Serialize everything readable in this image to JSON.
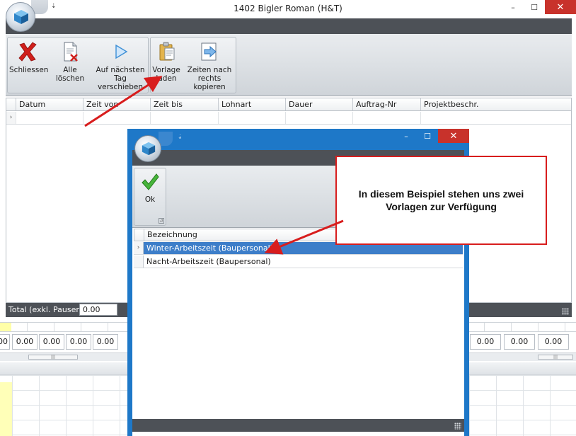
{
  "window": {
    "title": "1402 Bigler Roman (H&T)",
    "minimize": "–",
    "maximize": "☐",
    "close": "✕",
    "quick_access": "⇣"
  },
  "ribbon": {
    "buttons": [
      {
        "label1": "Schliessen",
        "label2": "",
        "icon": "red-x-icon"
      },
      {
        "label1": "Alle löschen",
        "label2": "",
        "icon": "delete-document-icon"
      },
      {
        "label1": "Auf nächsten",
        "label2": "Tag verschieben",
        "icon": "play-arrow-icon"
      },
      {
        "label1": "Vorlage",
        "label2": "laden",
        "icon": "clipboard-template-icon"
      },
      {
        "label1": "Zeiten nach",
        "label2": "rechts kopieren",
        "icon": "copy-right-icon"
      }
    ]
  },
  "grid": {
    "columns": [
      "Datum",
      "Zeit von",
      "Zeit bis",
      "Lohnart",
      "Dauer",
      "Auftrag-Nr",
      "Projektbeschr."
    ],
    "row_indicator": "›"
  },
  "total": {
    "label": "Total (exkl. Pausen)",
    "value": "0.00"
  },
  "lower_cells_left": [
    "00",
    "0.00",
    "0.00",
    "0.00",
    "0.00"
  ],
  "lower_cells_right": [
    "0.00",
    "0.00",
    "0.00"
  ],
  "scroll_grip": "|||",
  "dialog": {
    "ok_label": "Ok",
    "column": "Bezeichnung",
    "items": [
      "Winter-Arbeitszeit (Baupersonal)",
      "Nacht-Arbeitszeit (Baupersonal)"
    ],
    "row_indicator": "›",
    "minimize": "–",
    "maximize": "☐",
    "close": "✕",
    "quick_access": "⇣",
    "launcher": "⊿"
  },
  "callout": {
    "text": "In diesem Beispiel stehen uns zwei Vorlagen zur Verfügung"
  },
  "colors": {
    "dialog_border": "#1e78c8",
    "selected_row": "#3d7ec9",
    "annotation_red": "#d81d1d",
    "dark_bar": "#4d5157"
  }
}
